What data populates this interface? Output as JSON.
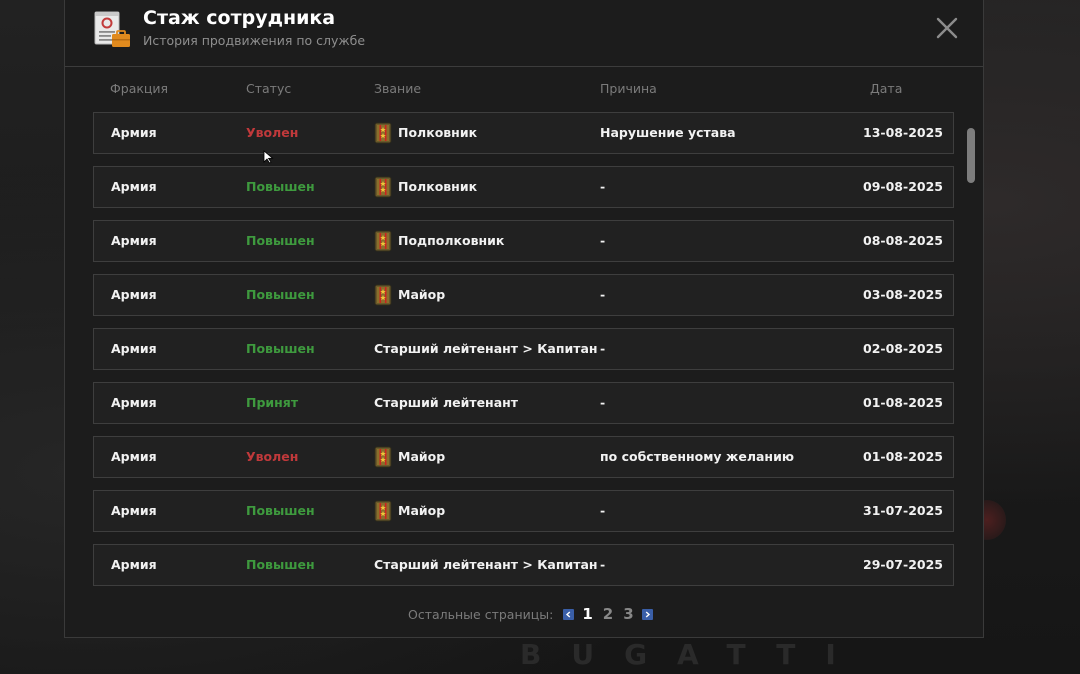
{
  "header": {
    "title": "Стаж сотрудника",
    "subtitle": "История продвижения по службе"
  },
  "columns": {
    "faction": "Фракция",
    "status": "Статус",
    "rank": "Звание",
    "reason": "Причина",
    "date": "Дата"
  },
  "rows": [
    {
      "faction": "Армия",
      "status": "Уволен",
      "status_color": "red",
      "rank_icon": true,
      "rank": "Полковник",
      "reason": "Нарушение устава",
      "date": "13-08-2025"
    },
    {
      "faction": "Армия",
      "status": "Повышен",
      "status_color": "green",
      "rank_icon": true,
      "rank": "Полковник",
      "reason": "-",
      "date": "09-08-2025"
    },
    {
      "faction": "Армия",
      "status": "Повышен",
      "status_color": "green",
      "rank_icon": true,
      "rank": "Подполковник",
      "reason": "-",
      "date": "08-08-2025"
    },
    {
      "faction": "Армия",
      "status": "Повышен",
      "status_color": "green",
      "rank_icon": true,
      "rank": "Майор",
      "reason": "-",
      "date": "03-08-2025"
    },
    {
      "faction": "Армия",
      "status": "Повышен",
      "status_color": "green",
      "rank_icon": false,
      "rank": "Старший лейтенант > Капитан",
      "reason": "-",
      "date": "02-08-2025"
    },
    {
      "faction": "Армия",
      "status": "Принят",
      "status_color": "green",
      "rank_icon": false,
      "rank": "Старший лейтенант",
      "reason": "-",
      "date": "01-08-2025"
    },
    {
      "faction": "Армия",
      "status": "Уволен",
      "status_color": "red",
      "rank_icon": true,
      "rank": "Майор",
      "reason": "по собственному желанию",
      "date": "01-08-2025"
    },
    {
      "faction": "Армия",
      "status": "Повышен",
      "status_color": "green",
      "rank_icon": true,
      "rank": "Майор",
      "reason": "-",
      "date": "31-07-2025"
    },
    {
      "faction": "Армия",
      "status": "Повышен",
      "status_color": "green",
      "rank_icon": false,
      "rank": "Старший лейтенант > Капитан",
      "reason": "-",
      "date": "29-07-2025"
    }
  ],
  "pager": {
    "label": "Остальные страницы:",
    "pages": [
      "1",
      "2",
      "3"
    ],
    "active_page": "1"
  },
  "background": {
    "brand": "BUGATTI"
  },
  "icons": {
    "header": "document-briefcase-icon",
    "close": "close-icon",
    "rank": "shoulder-strap-icon",
    "prev": "chevron-left-icon",
    "next": "chevron-right-icon"
  },
  "colors": {
    "status_red": "#c0393b",
    "status_green": "#3e9a3e",
    "pager_arrow": "#3a5fa8"
  }
}
